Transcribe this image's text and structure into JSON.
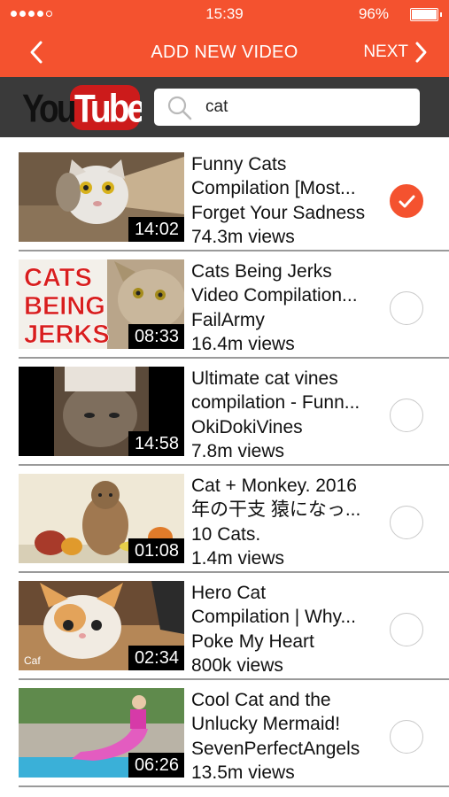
{
  "status_bar": {
    "time": "15:39",
    "battery": "96%"
  },
  "nav": {
    "title": "ADD NEW VIDEO",
    "next_label": "NEXT"
  },
  "brand": {
    "logo_you": "You",
    "logo_tube": "Tube"
  },
  "search": {
    "query": "cat"
  },
  "colors": {
    "accent": "#f4522f",
    "search_bar_bg": "#3a3a3a"
  },
  "videos": [
    {
      "line1": "Funny Cats",
      "line2": "Compilation [Most...",
      "line3": "Forget Your Sadness",
      "views": "74.3m views",
      "duration": "14:02",
      "selected": true
    },
    {
      "line1": "Cats Being Jerks",
      "line2": "Video Compilation...",
      "line3": "FailArmy",
      "views": "16.4m views",
      "duration": "08:33",
      "selected": false,
      "thumb_text": [
        "CATS",
        "BEING",
        "JERKS"
      ]
    },
    {
      "line1": "Ultimate cat vines",
      "line2": "compilation - Funn...",
      "line3": "OkiDokiVines",
      "views": "7.8m views",
      "duration": "14:58",
      "selected": false
    },
    {
      "line1": "Cat + Monkey. 2016",
      "line2": "年の干支 猿になっ...",
      "line3": "10 Cats.",
      "views": "1.4m views",
      "duration": "01:08",
      "selected": false
    },
    {
      "line1": "Hero Cat",
      "line2": "Compilation | Why...",
      "line3": "Poke My Heart",
      "views": "800k views",
      "duration": "02:34",
      "selected": false,
      "thumb_text": [
        "Caf"
      ]
    },
    {
      "line1": "Cool Cat and the",
      "line2": "Unlucky Mermaid!",
      "line3": "SevenPerfectAngels",
      "views": "13.5m views",
      "duration": "06:26",
      "selected": false
    }
  ]
}
